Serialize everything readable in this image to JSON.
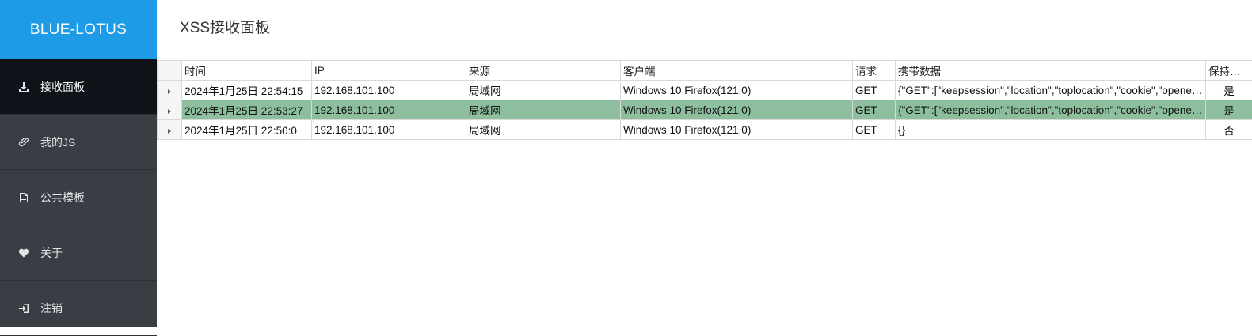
{
  "app": {
    "logo": "BLUE-LOTUS"
  },
  "header": {
    "title": "XSS接收面板"
  },
  "sidebar": {
    "items": [
      {
        "label": "接收面板",
        "icon": "download-icon"
      },
      {
        "label": "我的JS",
        "icon": "paperclip-icon"
      },
      {
        "label": "公共模板",
        "icon": "file-icon"
      },
      {
        "label": "关于",
        "icon": "heart-icon"
      },
      {
        "label": "注销",
        "icon": "sign-in-icon"
      }
    ]
  },
  "table": {
    "columns": [
      "时间",
      "IP",
      "来源",
      "客户端",
      "请求",
      "携带数据",
      "保持连接"
    ],
    "rows": [
      {
        "time": "2024年1月25日 22:54:15",
        "ip": "192.168.101.100",
        "source": "局域网",
        "client": "Windows 10 Firefox(121.0)",
        "method": "GET",
        "data": "{\"GET\":[\"keepsession\",\"location\",\"toplocation\",\"cookie\",\"opener\"]}",
        "keep": "是"
      },
      {
        "time": "2024年1月25日 22:53:27",
        "ip": "192.168.101.100",
        "source": "局域网",
        "client": "Windows 10 Firefox(121.0)",
        "method": "GET",
        "data": "{\"GET\":[\"keepsession\",\"location\",\"toplocation\",\"cookie\",\"opener\"]}",
        "keep": "是"
      },
      {
        "time": "2024年1月25日 22:50:0",
        "ip": "192.168.101.100",
        "source": "局域网",
        "client": "Windows 10 Firefox(121.0)",
        "method": "GET",
        "data": "{}",
        "keep": "否"
      }
    ]
  },
  "colors": {
    "logo_bg": "#1e9be6",
    "sidebar_bg": "#3a3d43",
    "active_item_bg": "#0f1218",
    "selected_row": "#8dbf9f"
  }
}
